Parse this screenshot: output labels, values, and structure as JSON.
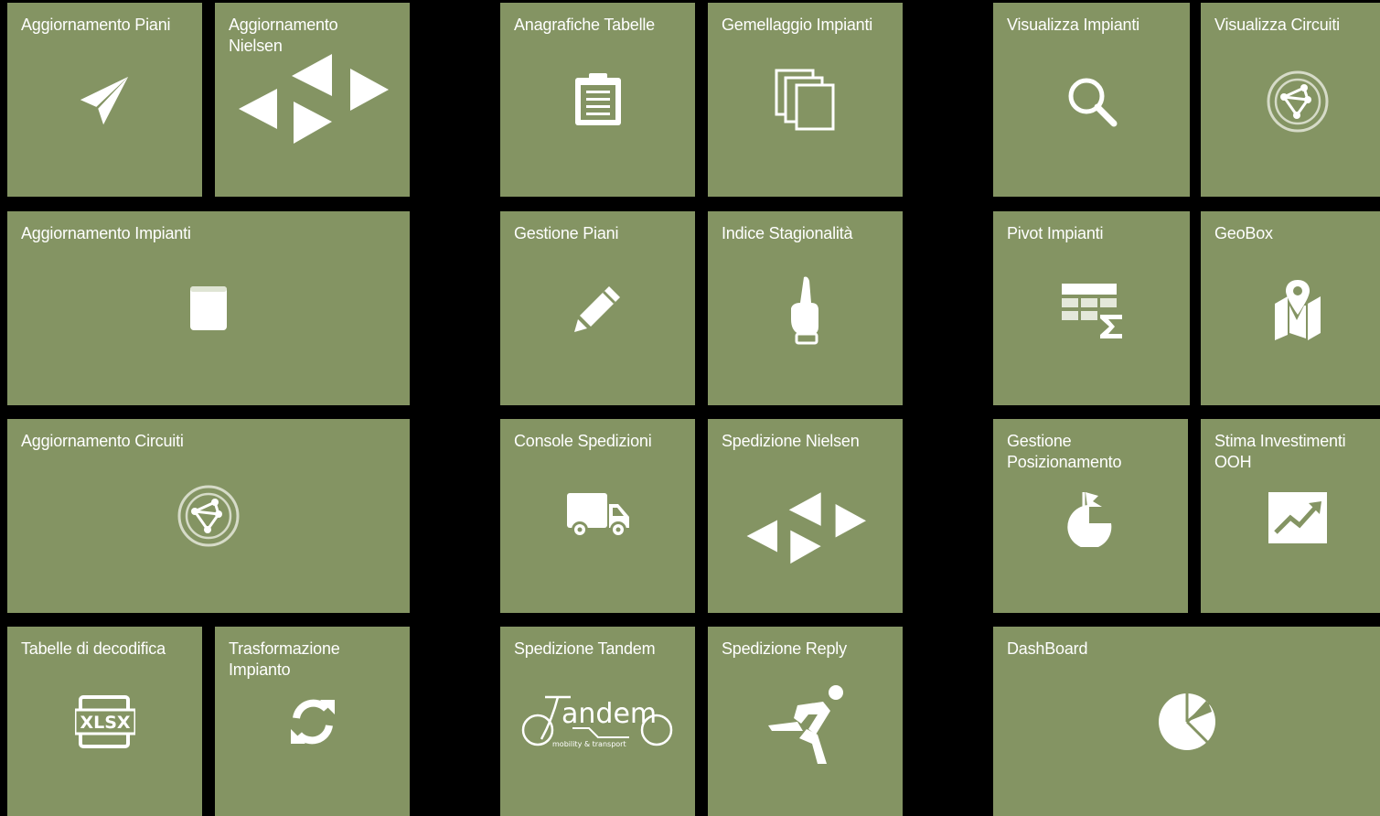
{
  "theme": {
    "tile_color": "#849463",
    "background": "#000000",
    "foreground": "#ffffff"
  },
  "tiles": {
    "aggiornamento_piani": {
      "label": "Aggiornamento Piani",
      "icon": "paper-plane-icon"
    },
    "aggiornamento_nielsen": {
      "label": "Aggiornamento\nNielsen",
      "icon": "nielsen-arrows-icon"
    },
    "aggiornamento_impianti": {
      "label": "Aggiornamento Impianti",
      "icon": "book-icon"
    },
    "aggiornamento_circuiti": {
      "label": "Aggiornamento Circuiti",
      "icon": "circuit-network-icon"
    },
    "tabelle_decodifica": {
      "label": "Tabelle di decodifica",
      "icon": "xlsx-file-icon",
      "icon_text": "XLSX"
    },
    "trasformazione_impianto": {
      "label": "Trasformazione\nImpianto",
      "icon": "refresh-icon"
    },
    "anagrafiche_tabelle": {
      "label": "Anagrafiche Tabelle",
      "icon": "clipboard-icon"
    },
    "gemellaggio_impianti": {
      "label": "Gemellaggio Impianti",
      "icon": "copy-icon"
    },
    "gestione_piani": {
      "label": "Gestione Piani",
      "icon": "pencil-icon"
    },
    "indice_stagionalita": {
      "label": "Indice Stagionalità",
      "icon": "pointing-hand-icon"
    },
    "console_spedizioni": {
      "label": "Console Spedizioni",
      "icon": "truck-icon"
    },
    "spedizione_nielsen": {
      "label": "Spedizione Nielsen",
      "icon": "nielsen-arrows-icon"
    },
    "spedizione_tandem": {
      "label": "Spedizione Tandem",
      "icon": "tandem-logo-icon",
      "logo_text": "andem",
      "logo_subtext": "mobility & transport"
    },
    "spedizione_reply": {
      "label": "Spedizione Reply",
      "icon": "running-man-icon"
    },
    "visualizza_impianti": {
      "label": "Visualizza Impianti",
      "icon": "search-icon"
    },
    "visualizza_circuiti": {
      "label": "Visualizza Circuiti",
      "icon": "circuit-network-icon"
    },
    "pivot_impianti": {
      "label": "Pivot Impianti",
      "icon": "pivot-table-sum-icon"
    },
    "geobox": {
      "label": "GeoBox",
      "icon": "map-marker-icon"
    },
    "gestione_posizionamento": {
      "label": "Gestione\nPosizionamento",
      "icon": "pie-flag-icon"
    },
    "stima_investimenti": {
      "label": "Stima Investimenti\nOOH",
      "icon": "trend-chart-icon"
    },
    "dashboard": {
      "label": "DashBoard",
      "icon": "pie-chart-icon"
    }
  }
}
